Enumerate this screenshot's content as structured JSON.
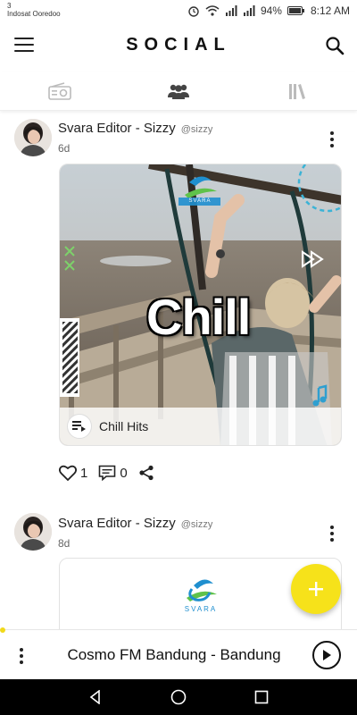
{
  "status_bar": {
    "carrier_line1": "3",
    "carrier_line2": "Indosat Ooredoo",
    "battery": "94%",
    "time": "8:12 AM"
  },
  "header": {
    "title": "SOCIAL",
    "menu_icon": "hamburger-icon",
    "search_icon": "search-icon"
  },
  "tabs": [
    {
      "icon": "radio-icon",
      "active": false
    },
    {
      "icon": "people-icon",
      "active": true
    },
    {
      "icon": "library-icon",
      "active": false
    }
  ],
  "posts": [
    {
      "author": "Svara Editor - Sizzy",
      "handle": "@sizzy",
      "time": "6d",
      "card_title": "Chill",
      "card_footer_label": "Chill Hits",
      "likes": "1",
      "comments": "0",
      "watermark": "SVARA"
    },
    {
      "author": "Svara Editor - Sizzy",
      "handle": "@sizzy",
      "time": "8d",
      "watermark": "SVARA"
    }
  ],
  "player": {
    "now_playing": "Cosmo FM Bandung - Bandung"
  },
  "colors": {
    "accent": "#f6e21a",
    "text": "#222222"
  }
}
